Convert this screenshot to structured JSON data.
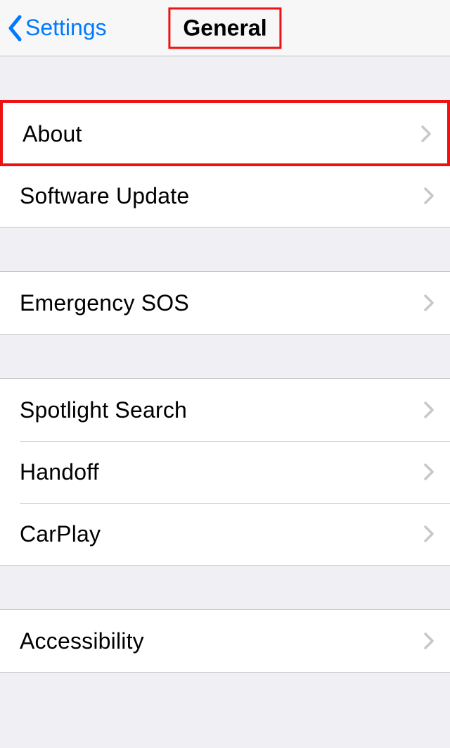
{
  "navbar": {
    "back_label": "Settings",
    "title": "General"
  },
  "groups": [
    {
      "items": [
        {
          "label": "About"
        },
        {
          "label": "Software Update"
        }
      ],
      "highlightFirst": true
    },
    {
      "items": [
        {
          "label": "Emergency SOS"
        }
      ]
    },
    {
      "items": [
        {
          "label": "Spotlight Search"
        },
        {
          "label": "Handoff"
        },
        {
          "label": "CarPlay"
        }
      ]
    },
    {
      "items": [
        {
          "label": "Accessibility"
        }
      ]
    }
  ]
}
